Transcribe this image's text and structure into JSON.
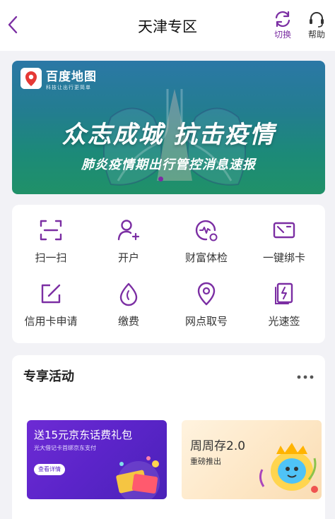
{
  "header": {
    "title": "天津专区",
    "switch_label": "切换",
    "help_label": "帮助",
    "back_icon": "chevron-left-icon",
    "switch_icon": "refresh-icon",
    "help_icon": "headset-icon"
  },
  "banner": {
    "logo_name": "百度地图",
    "logo_tagline": "科技让出行更简单",
    "headline": "众志成城 抗击疫情",
    "subheadline": "肺炎疫情期出行管控消息速报"
  },
  "services": [
    {
      "label": "扫一扫",
      "icon": "scan-icon"
    },
    {
      "label": "开户",
      "icon": "add-user-icon"
    },
    {
      "label": "财富体检",
      "icon": "health-check-icon"
    },
    {
      "label": "一键绑卡",
      "icon": "bind-card-icon"
    },
    {
      "label": "信用卡申请",
      "icon": "edit-icon"
    },
    {
      "label": "缴费",
      "icon": "water-drop-icon"
    },
    {
      "label": "网点取号",
      "icon": "location-pin-icon"
    },
    {
      "label": "光速签",
      "icon": "sign-card-icon"
    }
  ],
  "activities": {
    "title": "专享活动",
    "more_icon": "more-dots-icon",
    "items": [
      {
        "title": "送15元京东话费礼包",
        "subtitle": "光大借记卡首绑京东支付",
        "button": "查看详情"
      },
      {
        "title": "周周存2.0",
        "subtitle": "重磅推出"
      }
    ]
  },
  "colors": {
    "accent": "#7b2ea3",
    "page_bg": "#f2f2f6",
    "banner_teal": "#1c8a78"
  }
}
